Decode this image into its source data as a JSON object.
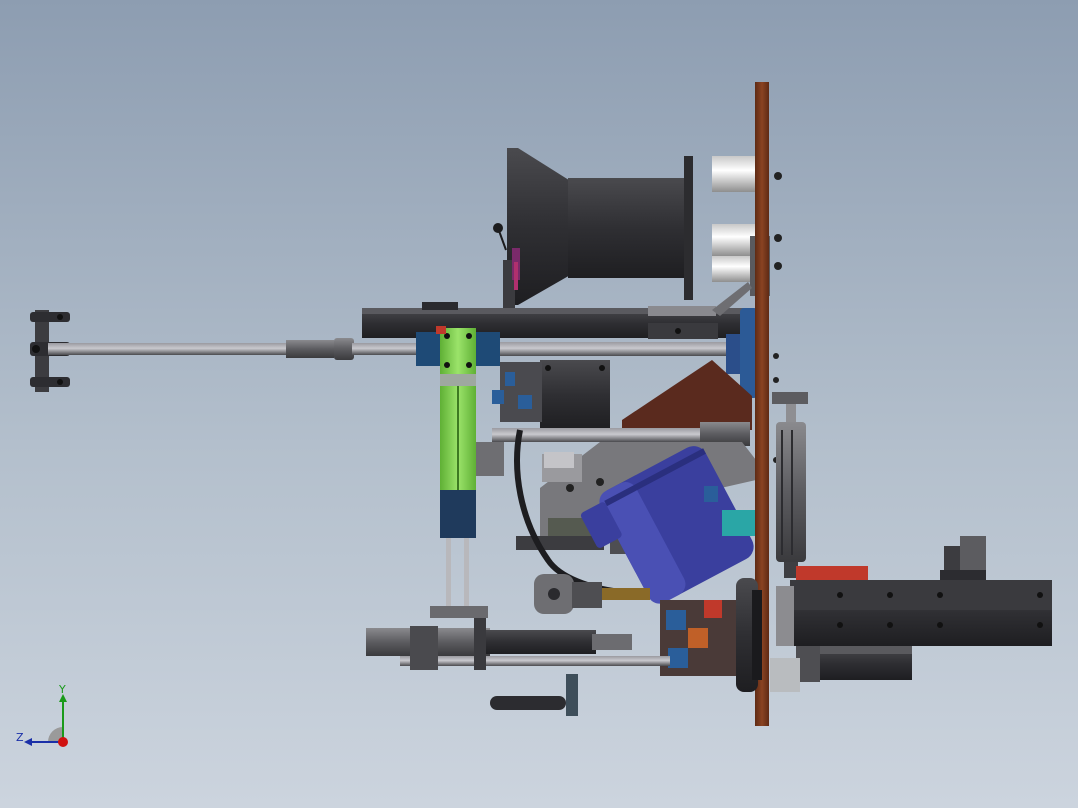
{
  "viewport": {
    "background_top": "#8d9db1",
    "background_bottom": "#ccd4de"
  },
  "triad": {
    "y_label": "Y",
    "z_label": "Z",
    "y_color": "#1a9a1a",
    "z_color": "#1a2fa8",
    "x_color": "#d01010"
  },
  "model": {
    "plate_color": "#7a3a1e",
    "motor_color": "#3a3f9e",
    "guide_color": "#7fd14a",
    "accent_teal": "#2aa6a6",
    "accent_red": "#c0392b",
    "steel_color": "#6e6e72",
    "dark_color": "#2b2b2e"
  }
}
